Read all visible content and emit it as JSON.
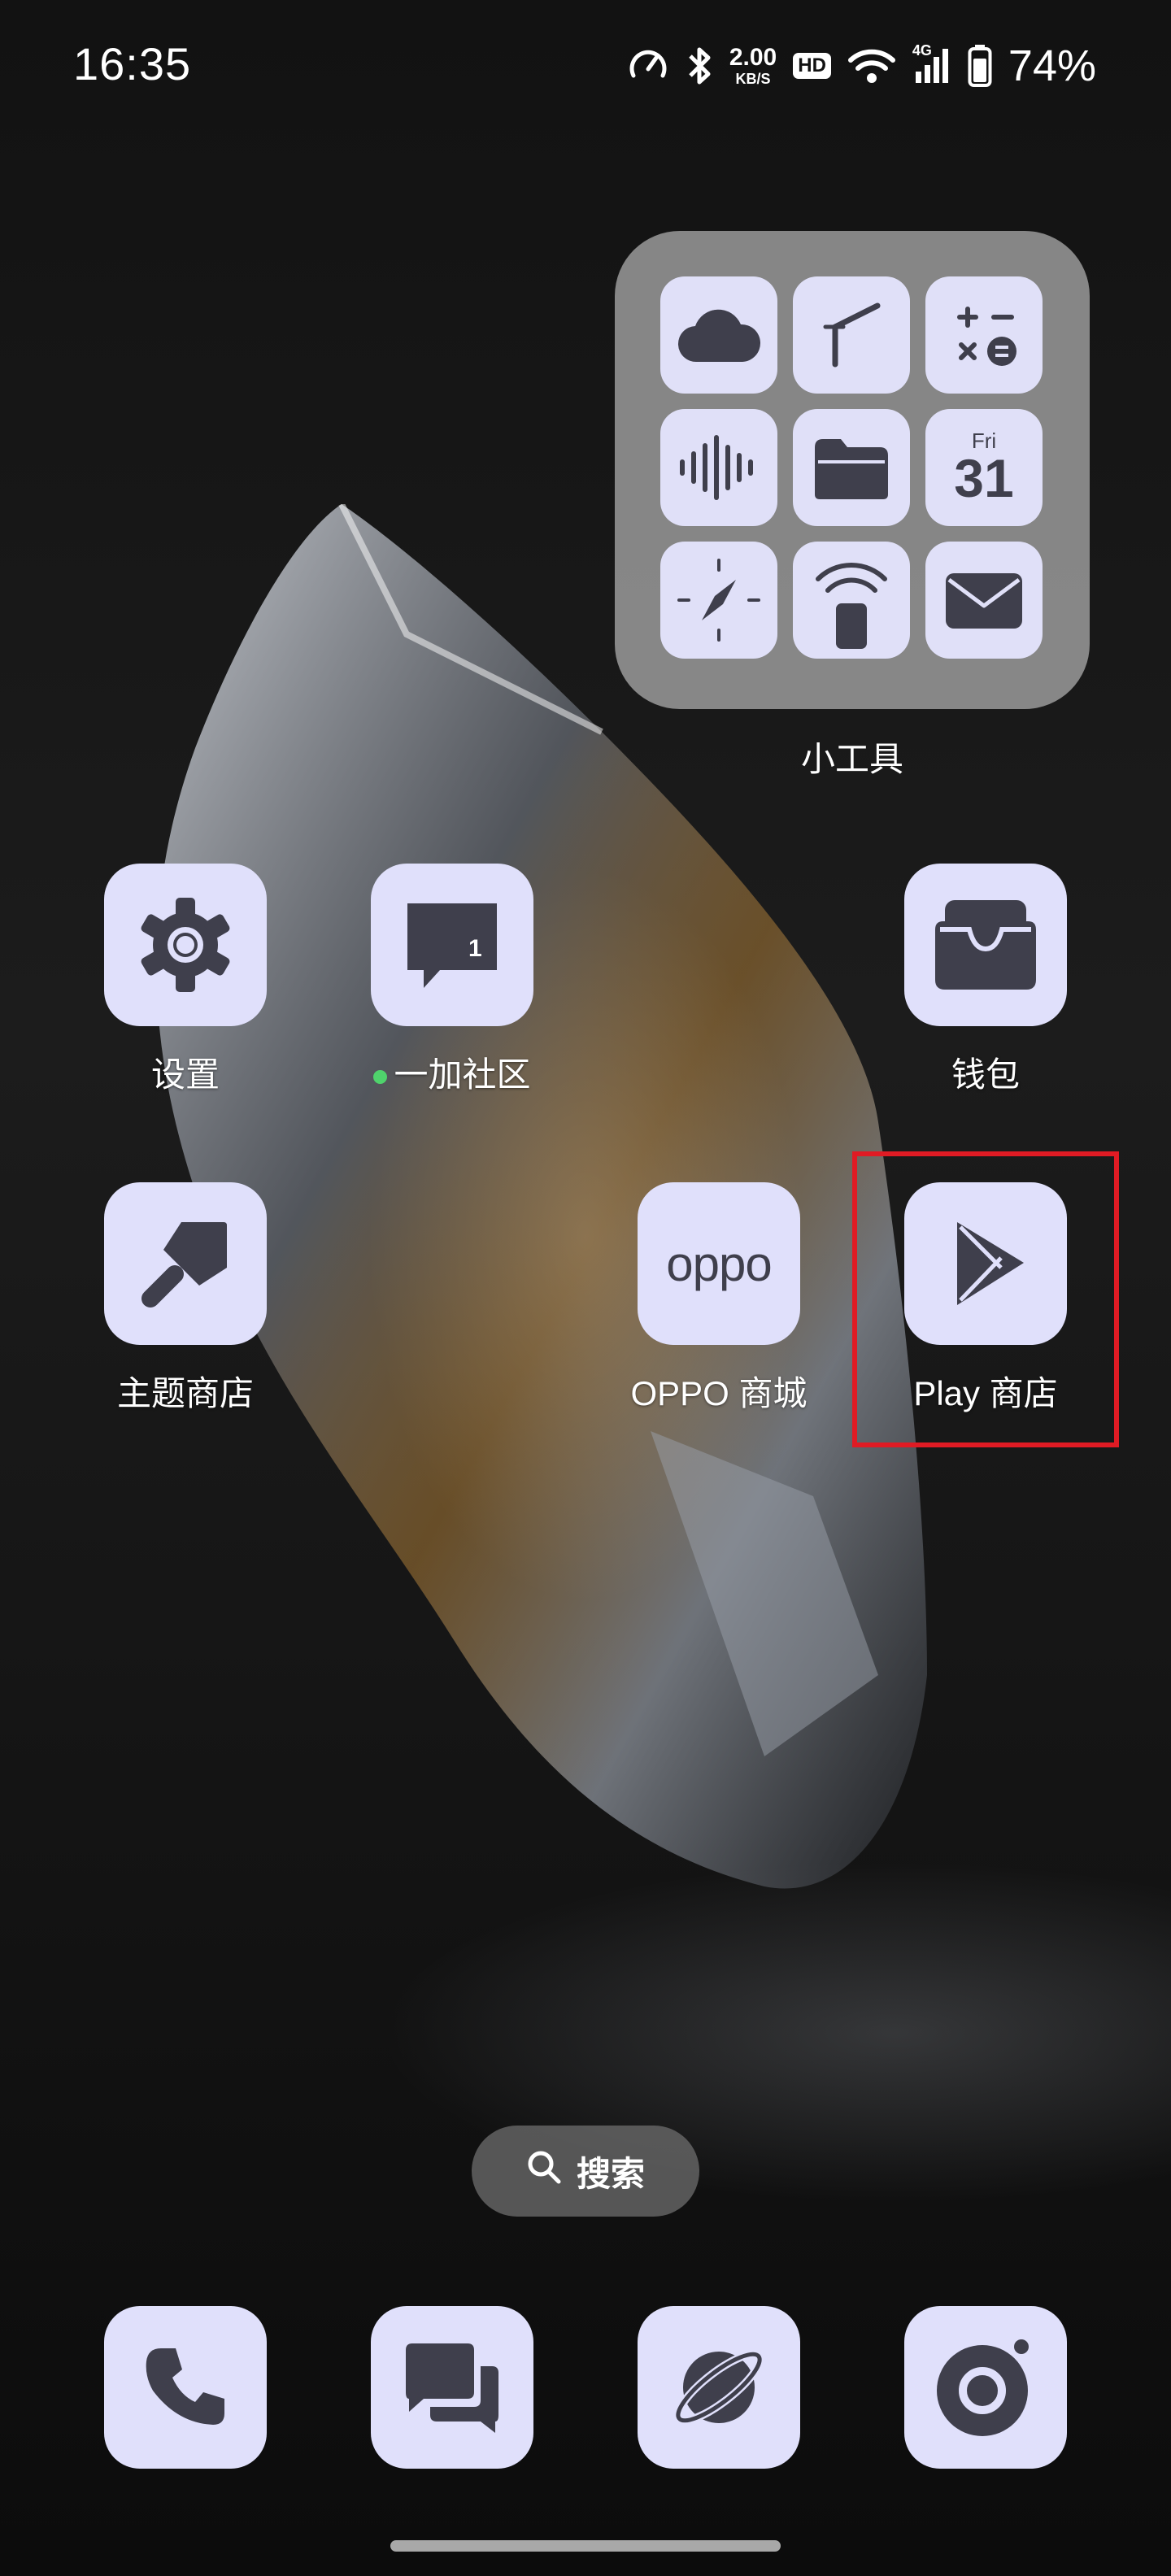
{
  "status_bar": {
    "time": "16:35",
    "net_speed_value": "2.00",
    "net_speed_unit": "KB/S",
    "hd_badge": "HD",
    "signal_label": "4G",
    "battery_percent": "74%",
    "icons": [
      "speedometer-icon",
      "bluetooth-icon",
      "wifi-icon",
      "signal-icon",
      "battery-icon"
    ]
  },
  "tools_folder": {
    "label": "小工具",
    "calendar_day": "Fri",
    "calendar_date": "31",
    "items": [
      "weather-icon",
      "level-icon",
      "calculator-icon",
      "recorder-icon",
      "file-manager-icon",
      "calendar-icon",
      "compass-icon",
      "remote-control-icon",
      "mail-icon"
    ]
  },
  "apps": {
    "settings": "设置",
    "community": "一加社区",
    "community_badge": "1",
    "wallet": "钱包",
    "theme_store": "主题商店",
    "oppo_store": "OPPO 商城",
    "oppo_logo": "oppo",
    "play_store": "Play 商店"
  },
  "search": {
    "label": "搜索"
  },
  "dock": [
    "phone-icon",
    "messages-icon",
    "browser-icon",
    "camera-icon"
  ],
  "colors": {
    "icon_bg": "#e0e0fb",
    "glyph": "#3f3f4c",
    "highlight": "#e01b24",
    "notification_dot": "#4fd36c"
  }
}
